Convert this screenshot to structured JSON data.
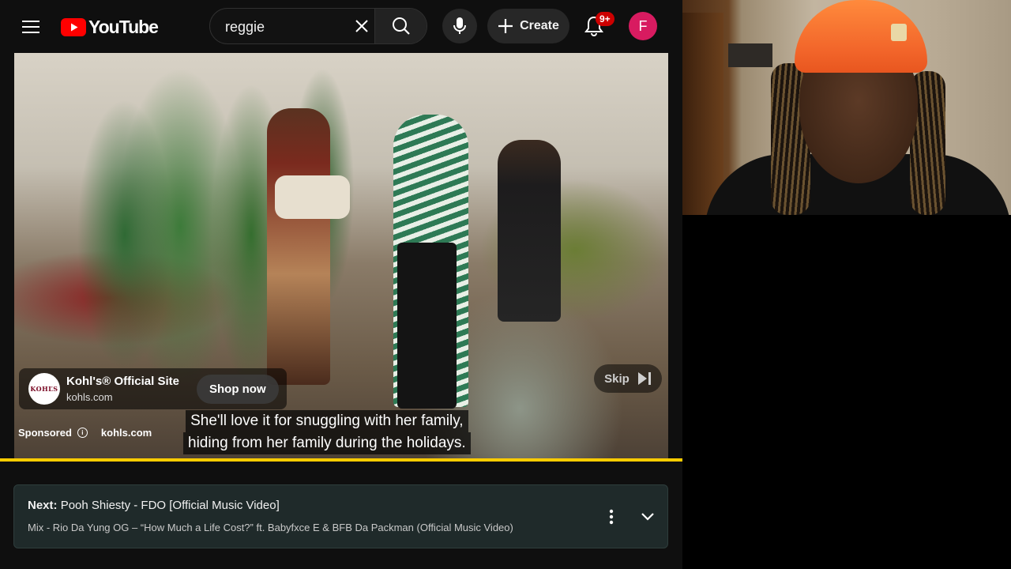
{
  "header": {
    "logo_text": "YouTube",
    "search": {
      "value": "reggie",
      "placeholder": "Search"
    },
    "create_label": "Create",
    "notification_badge": "9+",
    "avatar_initial": "F"
  },
  "ad": {
    "advertiser_logo_text": "KOHĽS",
    "title": "Kohl's® Official Site",
    "domain": "kohls.com",
    "cta_label": "Shop now",
    "sponsored_label": "Sponsored",
    "footer_domain": "kohls.com",
    "skip_label": "Skip"
  },
  "captions": [
    "She'll love it for snuggling with her family,",
    "hiding from her family during the holidays."
  ],
  "player": {
    "progress_fraction": 1.0
  },
  "up_next": {
    "prefix": "Next:",
    "title": "Pooh Shiesty - FDO [Official Music Video]",
    "subtitle": "Mix - Rio Da Yung OG – “How Much a Life Cost?” ft. Babyfxce E & BFB Da Packman (Official Music Video)"
  },
  "colors": {
    "accent_red": "#ff0000",
    "progress_yellow": "#ffcc00",
    "avatar_pink": "#d81b60",
    "next_card_bg": "#1f2a2a"
  },
  "icons": [
    "hamburger-menu-icon",
    "youtube-logo-icon",
    "close-icon",
    "search-icon",
    "mic-icon",
    "plus-icon",
    "bell-icon",
    "info-icon",
    "skip-next-icon",
    "more-vert-icon",
    "chevron-down-icon"
  ]
}
